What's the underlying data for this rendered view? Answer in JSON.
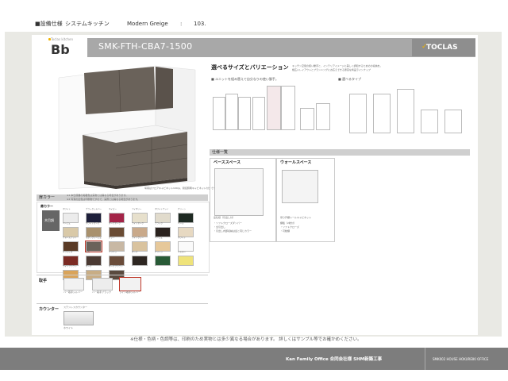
{
  "header": {
    "category": "■設備仕様",
    "product_type": "システムキッチン",
    "color_name": "Modern Greige",
    "separator": ":",
    "page_no": "103."
  },
  "logo": {
    "tagline": "Toclas kitchen",
    "name": "Bb"
  },
  "model_no": "SMK-FTH-CBA7-1500",
  "brand": "TOCLAS",
  "variation": {
    "title": "選べるサイズとバリエーション",
    "desc1": "キッチン空間の使い勝手と、インテリアイメージに美しく調和するためのの収納を。",
    "desc2": "幅広いレイアウトとプランニングにお応えできる豊富な商品ラインナップ",
    "sub1": "■ ユニットを組み替えて自分なりの使い勝手。",
    "sub2": "■ 選べるタイプ"
  },
  "main_image_caption": "写真はフロアキャビネット100㎝、間接照明キャビネット付きです。",
  "spec": {
    "title": "仕様一覧",
    "base_title": "ベーススペース",
    "base_caption": "扉仕様（引出し付）",
    "base_notes": [
      "・ソフトクローズダンパー",
      "・全引出し",
      "・引出し内部収納は扉と同じカラー"
    ],
    "wall_title": "ウォールスペース",
    "wall_caption": "吊り戸棚トールキャビネット",
    "wall_notes": [
      "棚板（2枚付）",
      "・ソフトクローズ",
      "・可動棚"
    ]
  },
  "door_color": {
    "label": "扉カラー",
    "note1": "※1 本仕様書の掲載色は実物とは異なる場合があります。",
    "note2": "※2 写真の扉色は印刷物ですので、実際とは異なる場合があります。",
    "grade_label": "扉カラー",
    "row_label": "木目調",
    "names": [
      "ホワイト",
      "ブラックシルバー",
      "ネイビー",
      "アイボリー",
      "ホワイトウッド",
      "グリーン",
      "ベージュ",
      "ホワイトオーク",
      "ダークオーク",
      "ライトオーク",
      "ブラック",
      "ペール",
      "ウォールナット",
      "モダングレージュ",
      "グレー",
      "ライトグレー",
      "ベージュ",
      "ホワイト",
      "テラコッタ",
      "モカ",
      "ブラウン",
      "ダーク",
      "グリーン",
      "イエロー",
      "ライトブラウン",
      "オーク",
      "ダークブラウン"
    ],
    "colors": [
      "#ececec",
      "#1d1f3a",
      "#a42448",
      "#e7e0cc",
      "#e1dbcc",
      "#1e2a22",
      "#d9c9a8",
      "#a9916d",
      "#6b4c34",
      "#c9a98a",
      "#2a221e",
      "#e7d9c2",
      "#5a3b26",
      "#6a625a",
      "#c8b8a4",
      "#d9c39f",
      "#e6c89a",
      "#fafafa",
      "#7b2b24",
      "#4b3a33",
      "#6a4c3a",
      "#2e2722",
      "#285a36",
      "#efe37a",
      "#d9a45b",
      "#c8ad85",
      "#5a4a3e"
    ]
  },
  "handle": {
    "label": "取手",
    "names": [
      "バー取手シルバー",
      "バー取手ブラック",
      "ライン取手シルバー"
    ]
  },
  "counter": {
    "label": "カウンター",
    "name": "ステンレスカウンター",
    "color_name": "ホワイト"
  },
  "footer": {
    "note": "※仕様・色柄・色調等は、印刷のため実物とは多少異なる場合があります。 詳しくはサンプル等でお確かめください。",
    "company": "Kan Family Office 合同会社様 SHM新築工事",
    "project": "SMK002 HOUSE HOKUREIKI OFFICE"
  },
  "colors": {
    "header_bar": "#a8a8a8",
    "frame": "#e9e9e4",
    "footer": "#7d7d7d",
    "cabinet": "#6a625a"
  }
}
